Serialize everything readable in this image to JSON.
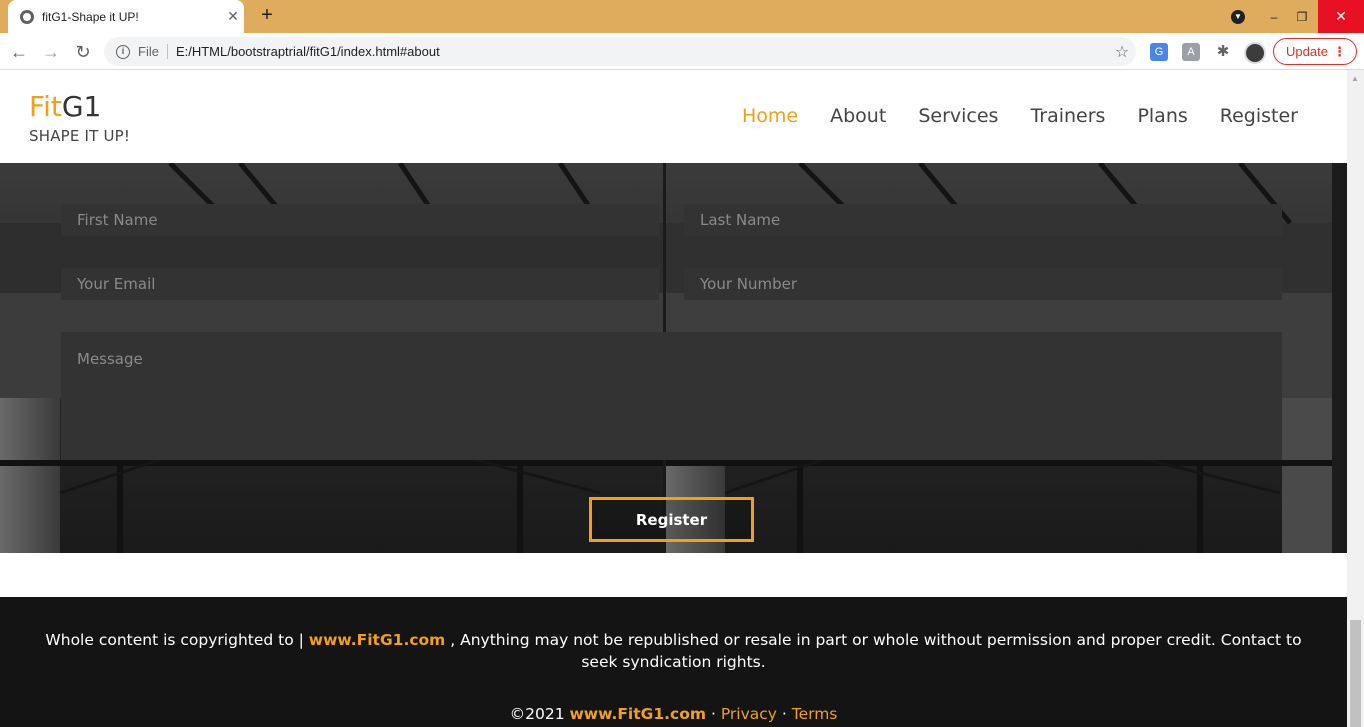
{
  "browser": {
    "tab_title": "fitG1-Shape it UP!",
    "tab_close": "✕",
    "new_tab": "+",
    "nav_back": "←",
    "nav_forward": "→",
    "nav_reload": "↻",
    "security_label": "File",
    "url": "E:/HTML/bootstraptrial/fitG1/index.html#about",
    "update_label": "Update",
    "win_min": "–",
    "win_max": "❐",
    "win_close": "✕"
  },
  "site": {
    "logo_part1": "Fit",
    "logo_part2": "G1",
    "tagline": "SHAPE IT UP!",
    "nav": [
      "Home",
      "About",
      "Services",
      "Trainers",
      "Plans",
      "Register"
    ]
  },
  "form": {
    "first_name_placeholder": "First Name",
    "last_name_placeholder": "Last Name",
    "email_placeholder": "Your Email",
    "number_placeholder": "Your Number",
    "message_placeholder": "Message",
    "submit_label": "Register"
  },
  "footer": {
    "copy_prefix": "Whole content is copyrighted to | ",
    "brand_link": "www.FitG1.com",
    "copy_suffix": " , Anything may not be republished or resale in part or whole without permission and proper credit. Contact to seek syndication rights.",
    "year": "©2021 ",
    "brand_link2": "www.FitG1.com",
    "sep1": " · ",
    "privacy": "Privacy",
    "sep2": " · ",
    "terms": "Terms"
  },
  "colors": {
    "accent": "#f0a01a",
    "tabbar": "#dfab5c",
    "footer_bg": "#141414",
    "field_bg": "#333333"
  }
}
